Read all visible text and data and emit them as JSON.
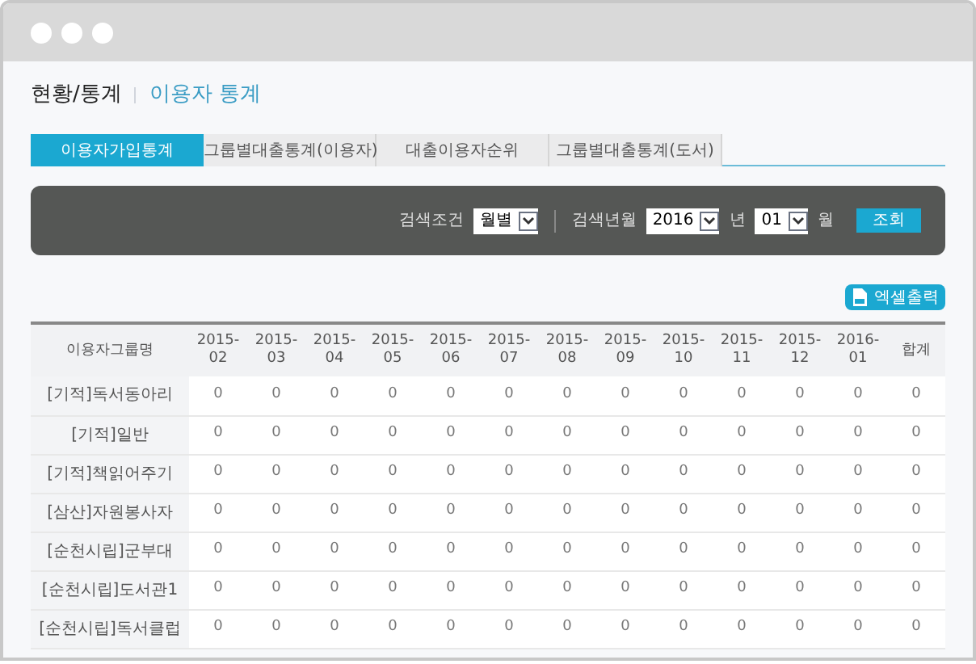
{
  "breadcrumb": {
    "section": "현황/통계",
    "page": "이용자 통계"
  },
  "tabs": [
    {
      "label": "이용자가입통계",
      "selected": true
    },
    {
      "label": "그룹별대출통계(이용자)",
      "selected": false
    },
    {
      "label": "대출이용자순위",
      "selected": false
    },
    {
      "label": "그룹별대출통계(도서)",
      "selected": false
    }
  ],
  "search": {
    "condition_label": "검색조건",
    "condition_value": "월별",
    "period_label": "검색년월",
    "year": "2016",
    "year_unit": "년",
    "month": "01",
    "month_unit": "월",
    "button": "조회"
  },
  "excel_button": "엑셀출력",
  "table": {
    "columns": [
      "이용자그룹명",
      "2015-02",
      "2015-03",
      "2015-04",
      "2015-05",
      "2015-06",
      "2015-07",
      "2015-08",
      "2015-09",
      "2015-10",
      "2015-11",
      "2015-12",
      "2016-01",
      "합계"
    ],
    "rows": [
      {
        "name": "[기적]독서동아리",
        "values": [
          "0",
          "0",
          "0",
          "0",
          "0",
          "0",
          "0",
          "0",
          "0",
          "0",
          "0",
          "0",
          "0"
        ]
      },
      {
        "name": "[기적]일반",
        "values": [
          "0",
          "0",
          "0",
          "0",
          "0",
          "0",
          "0",
          "0",
          "0",
          "0",
          "0",
          "0",
          "0"
        ]
      },
      {
        "name": "[기적]책읽어주기",
        "values": [
          "0",
          "0",
          "0",
          "0",
          "0",
          "0",
          "0",
          "0",
          "0",
          "0",
          "0",
          "0",
          "0"
        ]
      },
      {
        "name": "[삼산]자원봉사자",
        "values": [
          "0",
          "0",
          "0",
          "0",
          "0",
          "0",
          "0",
          "0",
          "0",
          "0",
          "0",
          "0",
          "0"
        ]
      },
      {
        "name": "[순천시립]군부대",
        "values": [
          "0",
          "0",
          "0",
          "0",
          "0",
          "0",
          "0",
          "0",
          "0",
          "0",
          "0",
          "0",
          "0"
        ]
      },
      {
        "name": "[순천시립]도서관1",
        "values": [
          "0",
          "0",
          "0",
          "0",
          "0",
          "0",
          "0",
          "0",
          "0",
          "0",
          "0",
          "0",
          "0"
        ]
      },
      {
        "name": "[순천시립]독서클럽",
        "values": [
          "0",
          "0",
          "0",
          "0",
          "0",
          "0",
          "0",
          "0",
          "0",
          "0",
          "0",
          "0",
          "0"
        ]
      }
    ]
  }
}
